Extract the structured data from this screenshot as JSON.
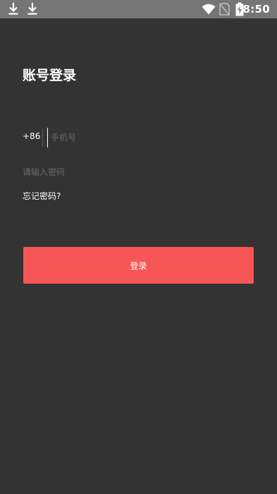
{
  "status_bar": {
    "time": "8:50",
    "icons": [
      "download-icon",
      "download-icon",
      "wifi-icon",
      "no-sim-icon",
      "battery-charging-icon"
    ]
  },
  "login": {
    "title": "账号登录",
    "country_code": "+86",
    "phone_placeholder": "手机号",
    "password_placeholder": "请输入密码",
    "forgot_password": "忘记密码?",
    "login_button": "登录"
  },
  "colors": {
    "background": "#333333",
    "status_bar": "#757575",
    "accent": "#f75656",
    "placeholder": "#6a6a6a"
  }
}
